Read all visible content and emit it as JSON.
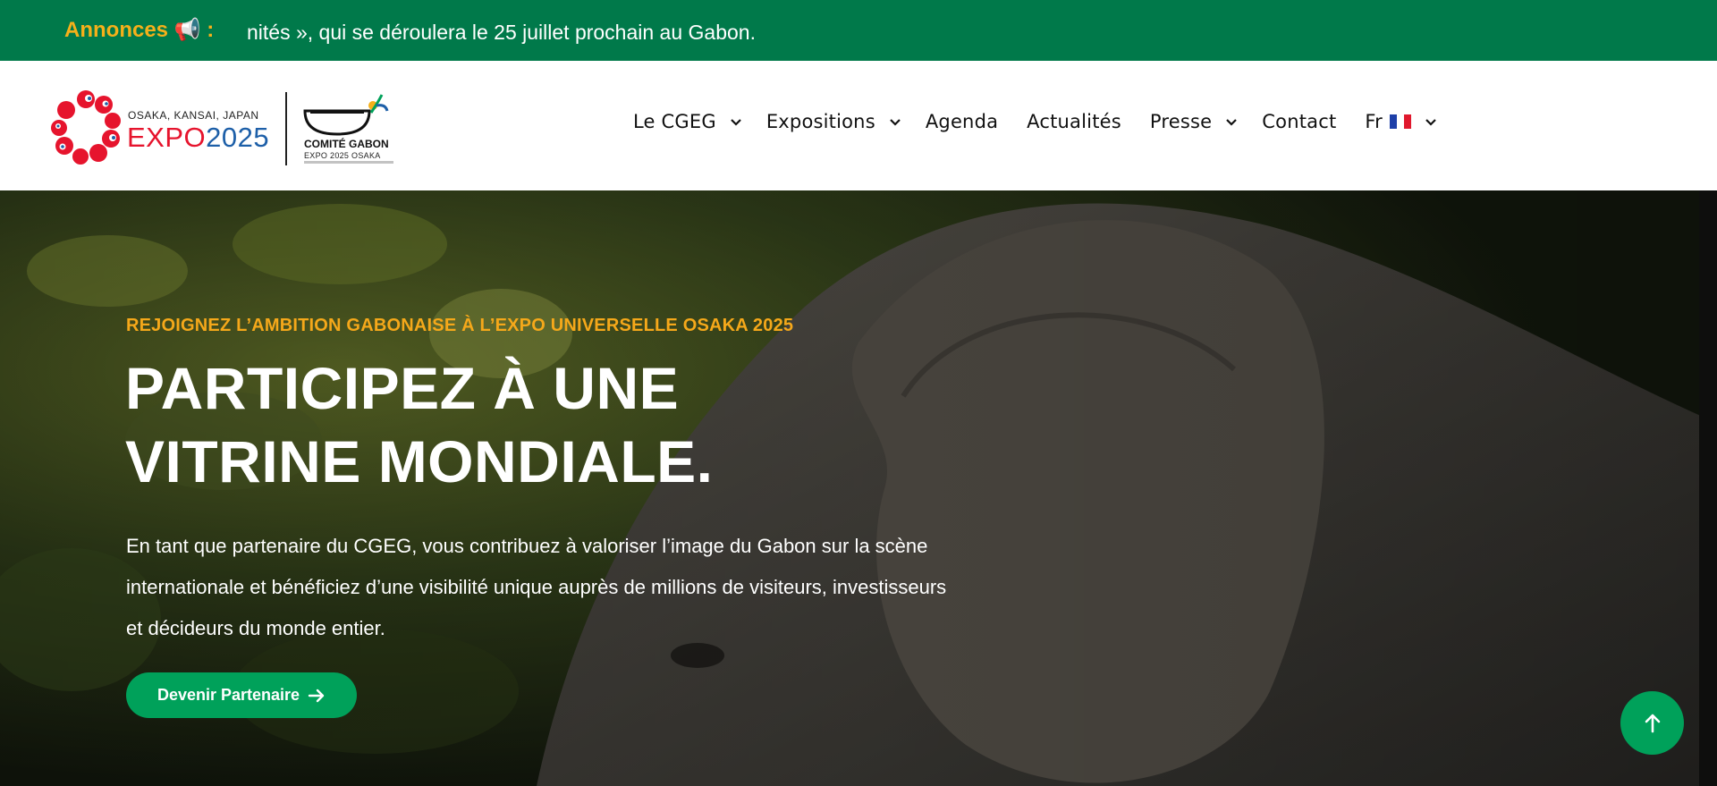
{
  "announcement": {
    "label": "Annonces 📢 :",
    "text": "nités », qui se déroulera le 25 juillet prochain au Gabon."
  },
  "logo": {
    "expo_small": "OSAKA, KANSAI, JAPAN",
    "expo_word": "EXPO",
    "expo_year": "2025",
    "gabon_name": "COMITÉ GABON",
    "gabon_sub": "EXPO 2025 OSAKA"
  },
  "nav": {
    "items": [
      {
        "label": "Le CGEG",
        "dropdown": true
      },
      {
        "label": "Expositions",
        "dropdown": true
      },
      {
        "label": "Agenda",
        "dropdown": false
      },
      {
        "label": "Actualités",
        "dropdown": false
      },
      {
        "label": "Presse",
        "dropdown": true
      },
      {
        "label": "Contact",
        "dropdown": false
      }
    ],
    "language": "Fr"
  },
  "hero": {
    "eyebrow": "REJOIGNEZ L’AMBITION GABONAISE À L’EXPO UNIVERSELLE OSAKA 2025",
    "title": "PARTICIPEZ À UNE VITRINE MONDIALE.",
    "text": "En tant que partenaire du CGEG, vous contribuez à valoriser l’image du Gabon sur la scène internationale et bénéficiez d’une visibilité unique auprès de millions de visiteurs, investisseurs et décideurs du monde entier.",
    "cta_label": "Devenir Partenaire"
  },
  "colors": {
    "announcement_bg": "#00794a",
    "accent_yellow": "#f5a81a",
    "cta_green": "#00a15a",
    "expo_red": "#e6142d",
    "expo_blue": "#1d5fa8",
    "flag_blue": "#1d3fa8",
    "flag_red": "#e0182d"
  },
  "icons": {
    "announcement": "megaphone-icon",
    "dropdown": "chevron-down-icon",
    "cta": "arrow-right-icon",
    "scroll_top": "arrow-up-icon",
    "language": "france-flag-icon"
  }
}
